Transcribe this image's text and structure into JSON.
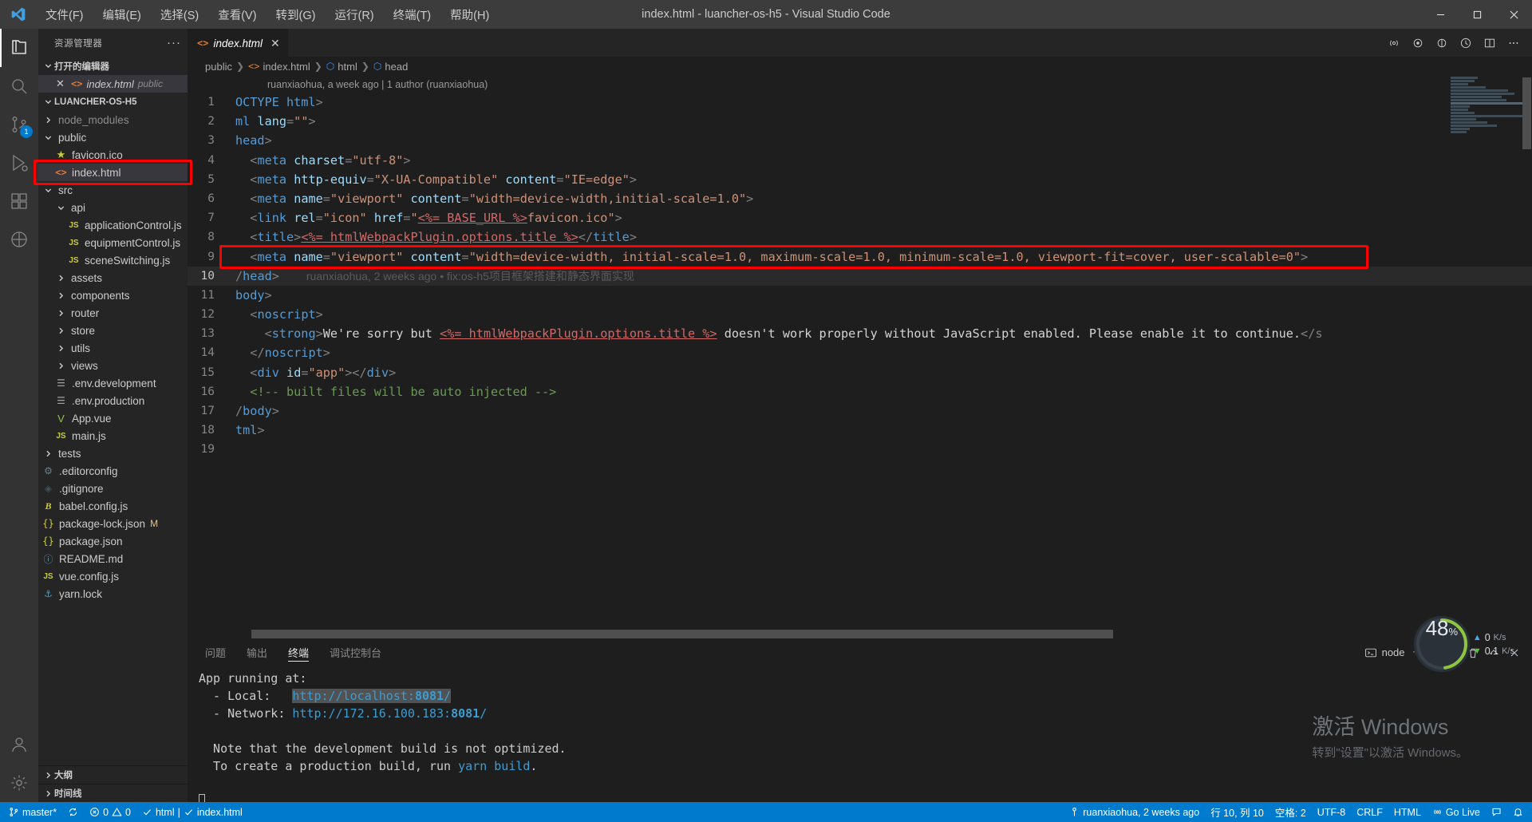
{
  "window": {
    "title": "index.html - luancher-os-h5 - Visual Studio Code",
    "menus": [
      "文件(F)",
      "编辑(E)",
      "选择(S)",
      "查看(V)",
      "转到(G)",
      "运行(R)",
      "终端(T)",
      "帮助(H)"
    ]
  },
  "activitybar": {
    "badge": "1",
    "items": [
      {
        "name": "explorer",
        "icon": "files-icon"
      },
      {
        "name": "search",
        "icon": "search-icon"
      },
      {
        "name": "scm",
        "icon": "source-control-icon"
      },
      {
        "name": "run",
        "icon": "debug-icon"
      },
      {
        "name": "extensions",
        "icon": "extensions-icon"
      },
      {
        "name": "remote",
        "icon": "remote-icon"
      },
      {
        "name": "account",
        "icon": "account-icon"
      },
      {
        "name": "settings",
        "icon": "gear-icon"
      }
    ]
  },
  "sidebar": {
    "title": "资源管理器",
    "more": "···",
    "open_editors": {
      "label": "打开的编辑器",
      "items": [
        {
          "name": "index.html",
          "path": "public",
          "close": "✕"
        }
      ]
    },
    "project": {
      "label": "LUANCHER-OS-H5",
      "tree": [
        {
          "label": "node_modules",
          "kind": "folder",
          "depth": 1,
          "expanded": false,
          "dim": true
        },
        {
          "label": "public",
          "kind": "folder",
          "depth": 1,
          "expanded": true
        },
        {
          "label": "favicon.ico",
          "kind": "star",
          "depth": 2
        },
        {
          "label": "index.html",
          "kind": "html",
          "depth": 2,
          "selected": true,
          "highlight": true
        },
        {
          "label": "src",
          "kind": "folder",
          "depth": 1,
          "expanded": true
        },
        {
          "label": "api",
          "kind": "folder",
          "depth": 2,
          "expanded": true
        },
        {
          "label": "applicationControl.js",
          "kind": "js",
          "depth": 3
        },
        {
          "label": "equipmentControl.js",
          "kind": "js",
          "depth": 3
        },
        {
          "label": "sceneSwitching.js",
          "kind": "js",
          "depth": 3
        },
        {
          "label": "assets",
          "kind": "folder",
          "depth": 2,
          "expanded": false
        },
        {
          "label": "components",
          "kind": "folder",
          "depth": 2,
          "expanded": false
        },
        {
          "label": "router",
          "kind": "folder",
          "depth": 2,
          "expanded": false
        },
        {
          "label": "store",
          "kind": "folder",
          "depth": 2,
          "expanded": false
        },
        {
          "label": "utils",
          "kind": "folder",
          "depth": 2,
          "expanded": false
        },
        {
          "label": "views",
          "kind": "folder",
          "depth": 2,
          "expanded": false
        },
        {
          "label": ".env.development",
          "kind": "env",
          "depth": 2
        },
        {
          "label": ".env.production",
          "kind": "env",
          "depth": 2
        },
        {
          "label": "App.vue",
          "kind": "vue",
          "depth": 2
        },
        {
          "label": "main.js",
          "kind": "js",
          "depth": 2
        },
        {
          "label": "tests",
          "kind": "folder",
          "depth": 1,
          "expanded": false
        },
        {
          "label": ".editorconfig",
          "kind": "gear",
          "depth": 1
        },
        {
          "label": ".gitignore",
          "kind": "git",
          "depth": 1
        },
        {
          "label": "babel.config.js",
          "kind": "babel",
          "depth": 1
        },
        {
          "label": "package-lock.json",
          "kind": "json",
          "depth": 1,
          "badge": "M"
        },
        {
          "label": "package.json",
          "kind": "json",
          "depth": 1
        },
        {
          "label": "README.md",
          "kind": "md",
          "depth": 1
        },
        {
          "label": "vue.config.js",
          "kind": "js",
          "depth": 1
        },
        {
          "label": "yarn.lock",
          "kind": "yarn",
          "depth": 1
        }
      ]
    },
    "outline": "大纲",
    "timeline": "时间线"
  },
  "editor": {
    "tab": {
      "label": "index.html",
      "close": "✕"
    },
    "breadcrumb": [
      "public",
      "index.html",
      "html",
      "head"
    ],
    "blame": "ruanxiaohua, a week ago | 1 author (ruanxiaohua)",
    "inline_blame": "ruanxiaohua, 2 weeks ago • fix:os-h5项目框架搭建和静态界面实现",
    "lines": [
      {
        "n": 1,
        "html": "<span class=\"t-tag\">OCTYPE html</span><span class=\"t-punc\">&gt;</span>"
      },
      {
        "n": 2,
        "html": "<span class=\"t-tag\">ml </span><span class=\"t-attr\">lang</span><span class=\"t-punc\">=</span><span class=\"t-str\">\"\"</span><span class=\"t-punc\">&gt;</span>"
      },
      {
        "n": 3,
        "html": "<span class=\"t-tag\">head</span><span class=\"t-punc\">&gt;</span>"
      },
      {
        "n": 4,
        "html": "  <span class=\"t-punc\">&lt;</span><span class=\"t-tag\">meta</span> <span class=\"t-attr\">charset</span><span class=\"t-punc\">=</span><span class=\"t-str\">\"utf-8\"</span><span class=\"t-punc\">&gt;</span>"
      },
      {
        "n": 5,
        "html": "  <span class=\"t-punc\">&lt;</span><span class=\"t-tag\">meta</span> <span class=\"t-attr\">http-equiv</span><span class=\"t-punc\">=</span><span class=\"t-str\">\"X-UA-Compatible\"</span> <span class=\"t-attr\">content</span><span class=\"t-punc\">=</span><span class=\"t-str\">\"IE=edge\"</span><span class=\"t-punc\">&gt;</span>"
      },
      {
        "n": 6,
        "html": "  <span class=\"t-punc\">&lt;</span><span class=\"t-tag\">meta</span> <span class=\"t-attr\">name</span><span class=\"t-punc\">=</span><span class=\"t-str\">\"viewport\"</span> <span class=\"t-attr\">content</span><span class=\"t-punc\">=</span><span class=\"t-str\">\"width=device-width,initial-scale=1.0\"</span><span class=\"t-punc\">&gt;</span>"
      },
      {
        "n": 7,
        "html": "  <span class=\"t-punc\">&lt;</span><span class=\"t-tag\">link</span> <span class=\"t-attr\">rel</span><span class=\"t-punc\">=</span><span class=\"t-str\">\"icon\"</span> <span class=\"t-attr\">href</span><span class=\"t-punc\">=</span><span class=\"t-str\">\"</span><span class=\"t-ejs\">&lt;%= BASE_URL %&gt;</span><span class=\"t-str\">favicon.ico\"</span><span class=\"t-punc\">&gt;</span>"
      },
      {
        "n": 8,
        "html": "  <span class=\"t-punc\">&lt;</span><span class=\"t-tag\">title</span><span class=\"t-punc\">&gt;</span><span class=\"t-ejs\">&lt;%= htmlWebpackPlugin.options.title %&gt;</span><span class=\"t-punc\">&lt;/</span><span class=\"t-tag\">title</span><span class=\"t-punc\">&gt;</span>"
      },
      {
        "n": 9,
        "html": "  <span class=\"t-punc\">&lt;</span><span class=\"t-tag\">meta</span> <span class=\"t-attr\">name</span><span class=\"t-punc\">=</span><span class=\"t-str\">\"viewport\"</span> <span class=\"t-attr\">content</span><span class=\"t-punc\">=</span><span class=\"t-str\">\"width=device-width, initial-scale=1.0, maximum-scale=1.0, minimum-scale=1.0, viewport-fit=cover, user-scalable=0\"</span><span class=\"t-punc\">&gt;</span>",
        "boxed": true
      },
      {
        "n": 10,
        "html": "<span class=\"t-punc\">/</span><span class=\"t-tag\">head</span><span class=\"t-punc\">&gt;</span>",
        "current": true,
        "blame": true
      },
      {
        "n": 11,
        "html": "<span class=\"t-tag\">body</span><span class=\"t-punc\">&gt;</span>"
      },
      {
        "n": 12,
        "html": "  <span class=\"t-punc\">&lt;</span><span class=\"t-tag\">noscript</span><span class=\"t-punc\">&gt;</span>"
      },
      {
        "n": 13,
        "html": "    <span class=\"t-punc\">&lt;</span><span class=\"t-tag\">strong</span><span class=\"t-punc\">&gt;</span><span class=\"t-txt\">We're sorry but </span><span class=\"t-ejs\">&lt;%= htmlWebpackPlugin.options.title %&gt;</span><span class=\"t-txt\"> doesn't work properly without JavaScript enabled. Please enable it to continue.</span><span class=\"t-punc\">&lt;/s</span>"
      },
      {
        "n": 14,
        "html": "  <span class=\"t-punc\">&lt;/</span><span class=\"t-tag\">noscript</span><span class=\"t-punc\">&gt;</span>"
      },
      {
        "n": 15,
        "html": "  <span class=\"t-punc\">&lt;</span><span class=\"t-tag\">div</span> <span class=\"t-attr\">id</span><span class=\"t-punc\">=</span><span class=\"t-str\">\"app\"</span><span class=\"t-punc\">&gt;&lt;/</span><span class=\"t-tag\">div</span><span class=\"t-punc\">&gt;</span>"
      },
      {
        "n": 16,
        "html": "  <span class=\"t-comm\">&lt;!-- built files will be auto injected --&gt;</span>"
      },
      {
        "n": 17,
        "html": "<span class=\"t-punc\">/</span><span class=\"t-tag\">body</span><span class=\"t-punc\">&gt;</span>"
      },
      {
        "n": 18,
        "html": "<span class=\"t-tag\">tml</span><span class=\"t-punc\">&gt;</span>"
      },
      {
        "n": 19,
        "html": ""
      }
    ]
  },
  "panel": {
    "tabs": [
      {
        "label": "问题",
        "active": false
      },
      {
        "label": "输出",
        "active": false
      },
      {
        "label": "终端",
        "active": true
      },
      {
        "label": "调试控制台",
        "active": false
      }
    ],
    "shell": "node",
    "add": "+",
    "terminal": {
      "l1": "App running at:",
      "l2_label": "  - Local:   ",
      "l2_link": "http://localhost:",
      "l2_port": "8081",
      "l2_tail": "/",
      "l3_label": "  - Network: ",
      "l3_link": "http://172.16.100.183:",
      "l3_port": "8081",
      "l3_tail": "/",
      "l5": "  Note that the development build is not optimized.",
      "l6a": "  To create a production build, run ",
      "l6b": "yarn build",
      "l6c": "."
    }
  },
  "perf": {
    "cpu": "48",
    "pct": "%",
    "up": "0",
    "up_unit": "K/s",
    "down": "0.1",
    "down_unit": "K/s"
  },
  "watermark": {
    "line1": "激活 Windows",
    "line2": "转到\"设置\"以激活 Windows。"
  },
  "statusbar": {
    "branch": "master*",
    "errors": "0",
    "warnings": "0",
    "ports": "html | ✓ index.html",
    "ports_left": "html",
    "ports_right": "index.html",
    "author": "ruanxiaohua, 2 weeks ago",
    "position": "行 10, 列 10",
    "spaces": "空格: 2",
    "encoding": "UTF-8",
    "eol": "CRLF",
    "language": "HTML",
    "golive": "Go Live"
  },
  "colors": {
    "accent": "#007acc",
    "titlebar": "#3c3c3c",
    "sidebar": "#252526",
    "editor": "#1e1e1e",
    "highlight_box": "#ff0000"
  }
}
